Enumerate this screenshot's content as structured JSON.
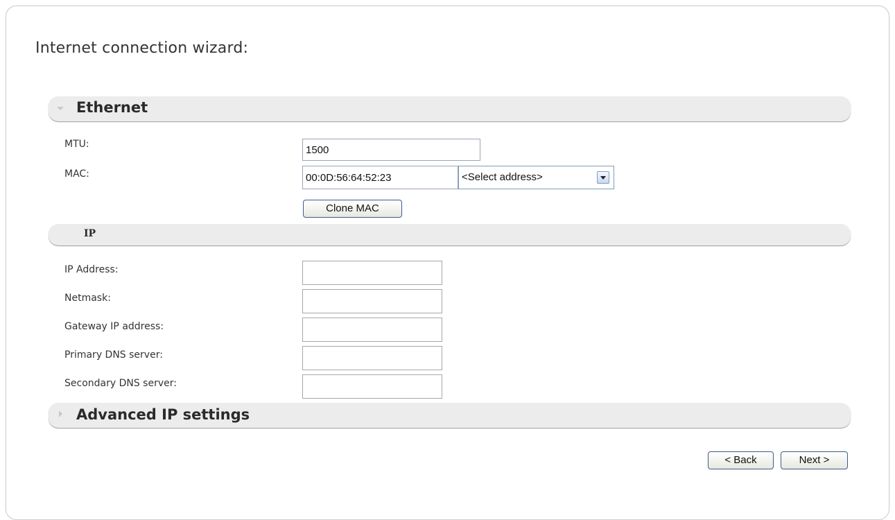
{
  "wizard": {
    "title": "Internet connection wizard:"
  },
  "ethernet": {
    "header": "Ethernet",
    "mtu_label": "MTU:",
    "mtu_value": "1500",
    "mac_label": "MAC:",
    "mac_value": "00:0D:56:64:52:23",
    "mac_select_value": "<Select address>",
    "clone_mac_label": "Clone MAC"
  },
  "ip": {
    "header": "IP",
    "fields": [
      {
        "label": "IP Address:",
        "value": ""
      },
      {
        "label": "Netmask:",
        "value": ""
      },
      {
        "label": "Gateway IP address:",
        "value": ""
      },
      {
        "label": "Primary DNS server:",
        "value": ""
      },
      {
        "label": "Secondary DNS server:",
        "value": ""
      }
    ]
  },
  "advanced": {
    "header": "Advanced IP settings"
  },
  "footer": {
    "back_label": "< Back",
    "next_label": "Next >"
  }
}
